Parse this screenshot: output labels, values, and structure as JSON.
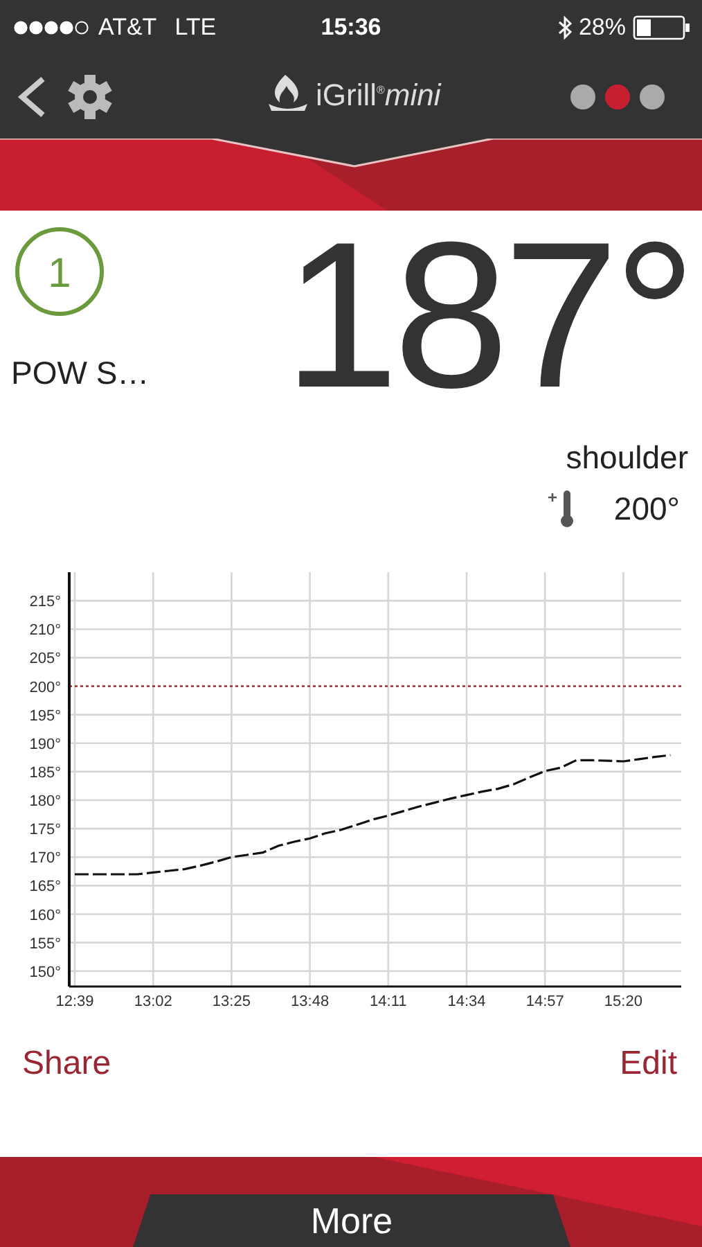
{
  "status_bar": {
    "carrier": "AT&T",
    "network": "LTE",
    "time": "15:36",
    "battery": "28%"
  },
  "nav": {
    "logo": "iGrill$^{®}$*mini*",
    "pages": [
      {
        "selected": false
      },
      {
        "selected": true
      },
      {
        "selected": false
      }
    ]
  },
  "probe": {
    "number": "1",
    "name": "POW S…",
    "temperature": "187°",
    "label": "shoulder",
    "target": "200°"
  },
  "chart_data": {
    "type": "line",
    "ylim": [
      147.3,
      220
    ],
    "categories": [
      "12:39",
      null,
      null,
      null,
      null,
      "13:02",
      null,
      null,
      null,
      null,
      "13:25",
      null,
      null,
      null,
      null,
      "13:48",
      null,
      null,
      null,
      null,
      "14:11",
      null,
      null,
      null,
      null,
      "14:34",
      null,
      null,
      null,
      null,
      "14:57",
      null,
      null,
      null,
      null,
      "15:20",
      null,
      null,
      null
    ],
    "yticks": [
      {
        "value": 150,
        "label": "150°"
      },
      {
        "value": 155,
        "label": "155°"
      },
      {
        "value": 160,
        "label": "160°"
      },
      {
        "value": 165,
        "label": "165°"
      },
      {
        "value": 170,
        "label": "170°"
      },
      {
        "value": 175,
        "label": "175°"
      },
      {
        "value": 180,
        "label": "180°"
      },
      {
        "value": 185,
        "label": "185°"
      },
      {
        "value": 190,
        "label": "190°"
      },
      {
        "value": 195,
        "label": "195°"
      },
      {
        "value": 200,
        "label": "200°"
      },
      {
        "value": 205,
        "label": "205°"
      },
      {
        "value": 210,
        "label": "210°"
      },
      {
        "value": 215,
        "label": "215°"
      }
    ],
    "grid": true,
    "series": [
      {
        "color": "#111111",
        "line_style": "dashed",
        "values": [
          167,
          167,
          167,
          167,
          167,
          167.3,
          167.6,
          167.9,
          168.5,
          169.2,
          170,
          170.4,
          170.8,
          172,
          172.7,
          173.3,
          174.2,
          174.8,
          175.7,
          176.6,
          177.3,
          178.1,
          178.9,
          179.6,
          180.3,
          180.9,
          181.5,
          182,
          182.8,
          184,
          185.1,
          185.7,
          187,
          187,
          186.9,
          186.8,
          187.2,
          187.6,
          187.9
        ]
      }
    ],
    "ref_lines": [
      {
        "axis": "y",
        "value": 200,
        "color": "#a0282f",
        "line_style": "dotted"
      }
    ]
  },
  "actions": {
    "share": "Share",
    "edit": "Edit",
    "more": "More"
  }
}
